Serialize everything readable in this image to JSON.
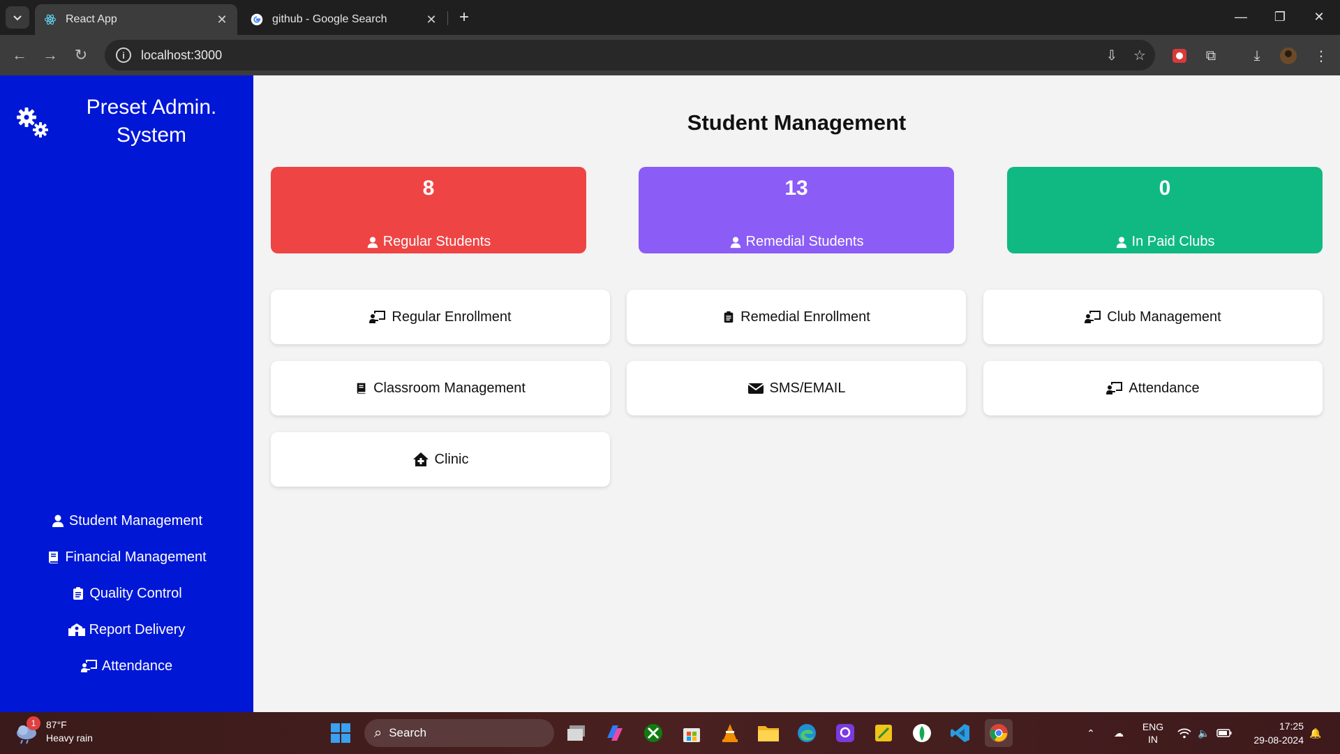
{
  "browser": {
    "tabs": [
      {
        "title": "React App",
        "active": true,
        "icon": "react-icon"
      },
      {
        "title": "github - Google Search",
        "active": false,
        "icon": "google-icon"
      }
    ],
    "url": "localhost:3000"
  },
  "sidebar": {
    "brand_title": "Preset Admin. System",
    "brand_icon": "gears-icon",
    "items": [
      {
        "label": "Student Management",
        "icon": "user-icon"
      },
      {
        "label": "Financial Management",
        "icon": "book-icon"
      },
      {
        "label": "Quality Control",
        "icon": "clipboard-icon"
      },
      {
        "label": "Report Delivery",
        "icon": "school-icon"
      },
      {
        "label": "Attendance",
        "icon": "chalkboard-user-icon"
      }
    ]
  },
  "main": {
    "title": "Student Management",
    "stats": [
      {
        "value": "8",
        "label": "Regular Students",
        "color": "#ef4444"
      },
      {
        "value": "13",
        "label": "Remedial Students",
        "color": "#8b5cf6"
      },
      {
        "value": "0",
        "label": "In Paid Clubs",
        "color": "#10b981"
      }
    ],
    "actions": [
      {
        "label": "Regular Enrollment",
        "icon": "chalkboard-user-icon"
      },
      {
        "label": "Remedial Enrollment",
        "icon": "clipboard-icon"
      },
      {
        "label": "Club Management",
        "icon": "chalkboard-user-icon"
      },
      {
        "label": "Classroom Management",
        "icon": "book-icon"
      },
      {
        "label": "SMS/EMAIL",
        "icon": "envelope-icon"
      },
      {
        "label": "Attendance",
        "icon": "chalkboard-user-icon"
      },
      {
        "label": "Clinic",
        "icon": "house-medical-icon"
      }
    ]
  },
  "taskbar": {
    "weather_temp": "87°F",
    "weather_desc": "Heavy rain",
    "weather_badge": "1",
    "search_label": "Search",
    "lang_top": "ENG",
    "lang_bottom": "IN",
    "time": "17:25",
    "date": "29-08-2024"
  },
  "colors": {
    "sidebar_bg": "#0017d6",
    "page_bg": "#f3f3f3"
  }
}
